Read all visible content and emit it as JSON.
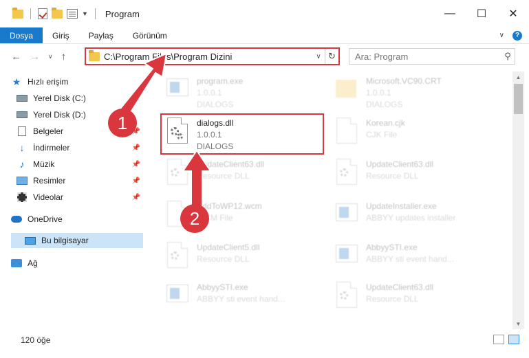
{
  "window": {
    "title": "Program",
    "controls": {
      "minimize": "—",
      "maximize": "☐",
      "close": "✕"
    }
  },
  "ribbon": {
    "tabs": [
      "Dosya",
      "Giriş",
      "Paylaş",
      "Görünüm"
    ],
    "help": "?"
  },
  "address": {
    "path": "C:\\Program Files\\Program Dizini",
    "search_placeholder": "Ara: Program"
  },
  "sidebar": {
    "items": [
      {
        "label": "Hızlı erişim",
        "icon": "star-icon"
      },
      {
        "label": "Yerel Disk (C:)",
        "icon": "disk-icon"
      },
      {
        "label": "Yerel Disk (D:)",
        "icon": "disk-icon"
      },
      {
        "label": "Belgeler",
        "icon": "document-icon"
      },
      {
        "label": "İndirmeler",
        "icon": "download-icon"
      },
      {
        "label": "Müzik",
        "icon": "music-icon"
      },
      {
        "label": "Resimler",
        "icon": "pictures-icon"
      },
      {
        "label": "Videolar",
        "icon": "video-icon"
      },
      {
        "label": "OneDrive",
        "icon": "cloud-icon"
      },
      {
        "label": "Bu bilgisayar",
        "icon": "computer-icon"
      },
      {
        "label": "Ağ",
        "icon": "network-icon"
      }
    ]
  },
  "files": [
    {
      "name": "program.exe",
      "line2": "1.0.0.1",
      "line3": "DIALOGS"
    },
    {
      "name": "Microsoft.VC90.CRT",
      "line2": "1.0.0.1",
      "line3": "DIALOGS"
    },
    {
      "name": "dialogs.dll",
      "line2": "1.0.0.1",
      "line3": "DIALOGS"
    },
    {
      "name": "Korean.cjk",
      "line2": "CJK File",
      "line3": ""
    },
    {
      "name": "UpdateClient63.dll",
      "line2": "Resource DLL",
      "line3": ""
    },
    {
      "name": "UpdateClient63.dll",
      "line2": "Resource DLL",
      "line3": ""
    },
    {
      "name": "AddToWP12.wcm",
      "line2": "WCM File",
      "line3": ""
    },
    {
      "name": "UpdateInstaller.exe",
      "line2": "ABBYY updates installer",
      "line3": ""
    },
    {
      "name": "UpdateClient5.dll",
      "line2": "Resource DLL",
      "line3": ""
    },
    {
      "name": "AbbyySTI.exe",
      "line2": "ABBYY sti event hand...",
      "line3": ""
    },
    {
      "name": "AbbyySTI.exe",
      "line2": "ABBYY sti event hand...",
      "line3": ""
    },
    {
      "name": "UpdateClient63.dll",
      "line2": "Resource DLL",
      "line3": ""
    }
  ],
  "status": {
    "count": "120 öğe"
  },
  "annotations": {
    "one": "1",
    "two": "2"
  },
  "colors": {
    "accent": "#1979ca",
    "highlight": "#d9363e",
    "selected": "#cce4f7"
  }
}
